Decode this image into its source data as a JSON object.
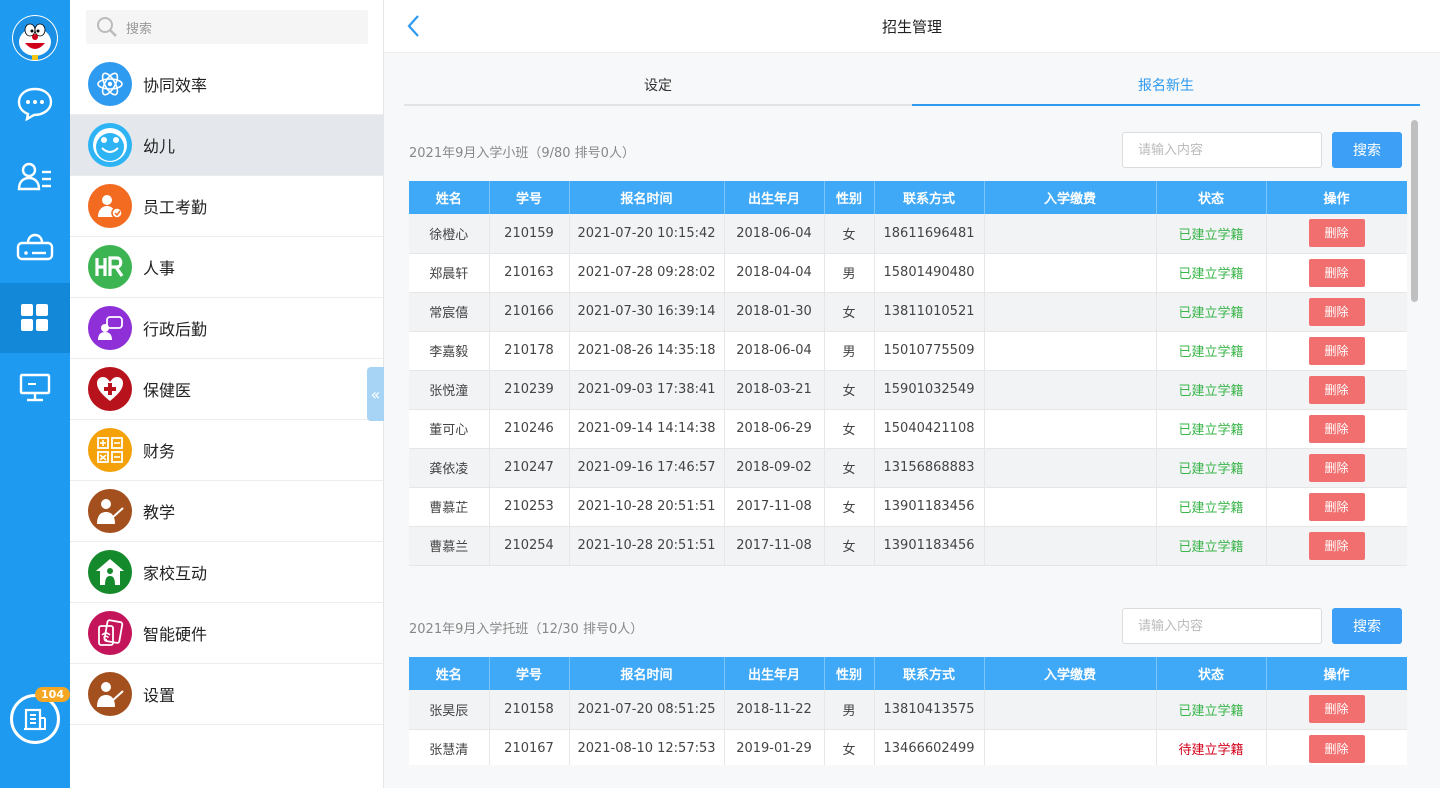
{
  "rail": {
    "badge_count": "104"
  },
  "menu": {
    "search_placeholder": "搜索",
    "items": [
      {
        "label": "协同效率",
        "icon": "atom-icon",
        "color": "#2e9af0"
      },
      {
        "label": "幼儿",
        "icon": "smiley-face-icon",
        "color": "#2e9af0"
      },
      {
        "label": "员工考勤",
        "icon": "staff-attendance-icon",
        "color": "#f26b21"
      },
      {
        "label": "人事",
        "icon": "hr-icon",
        "color": "#3cb451"
      },
      {
        "label": "行政后勤",
        "icon": "admin-logistics-icon",
        "color": "#8e2fd8"
      },
      {
        "label": "保健医",
        "icon": "health-heart-icon",
        "color": "#b8131c"
      },
      {
        "label": "财务",
        "icon": "finance-icon",
        "color": "#f5a10a"
      },
      {
        "label": "教学",
        "icon": "teaching-icon",
        "color": "#a34f1e"
      },
      {
        "label": "家校互动",
        "icon": "home-school-icon",
        "color": "#148a2c"
      },
      {
        "label": "智能硬件",
        "icon": "smart-hardware-icon",
        "color": "#c4155b"
      },
      {
        "label": "设置",
        "icon": "settings-person-icon",
        "color": "#a34f1e"
      }
    ]
  },
  "header": {
    "title": "招生管理"
  },
  "tabs": [
    {
      "label": "设定"
    },
    {
      "label": "报名新生"
    }
  ],
  "table_headers": [
    "姓名",
    "学号",
    "报名时间",
    "出生年月",
    "性别",
    "联系方式",
    "入学缴费",
    "状态",
    "操作"
  ],
  "sections": [
    {
      "title": "2021年9月入学小班（9/80 排号0人）",
      "search_placeholder": "请输入内容",
      "search_button": "搜索",
      "rows": [
        {
          "name": "徐橙心",
          "id": "210159",
          "time": "2021-07-20 10:15:42",
          "birth": "2018-06-04",
          "gender": "女",
          "phone": "18611696481",
          "fee": "",
          "status": "已建立学籍",
          "action": "删除"
        },
        {
          "name": "郑晨轩",
          "id": "210163",
          "time": "2021-07-28 09:28:02",
          "birth": "2018-04-04",
          "gender": "男",
          "phone": "15801490480",
          "fee": "",
          "status": "已建立学籍",
          "action": "删除"
        },
        {
          "name": "常宸僖",
          "id": "210166",
          "time": "2021-07-30 16:39:14",
          "birth": "2018-01-30",
          "gender": "女",
          "phone": "13811010521",
          "fee": "",
          "status": "已建立学籍",
          "action": "删除"
        },
        {
          "name": "李嘉毅",
          "id": "210178",
          "time": "2021-08-26 14:35:18",
          "birth": "2018-06-04",
          "gender": "男",
          "phone": "15010775509",
          "fee": "",
          "status": "已建立学籍",
          "action": "删除"
        },
        {
          "name": "张悦潼",
          "id": "210239",
          "time": "2021-09-03 17:38:41",
          "birth": "2018-03-21",
          "gender": "女",
          "phone": "15901032549",
          "fee": "",
          "status": "已建立学籍",
          "action": "删除"
        },
        {
          "name": "董可心",
          "id": "210246",
          "time": "2021-09-14 14:14:38",
          "birth": "2018-06-29",
          "gender": "女",
          "phone": "15040421108",
          "fee": "",
          "status": "已建立学籍",
          "action": "删除"
        },
        {
          "name": "龚依凌",
          "id": "210247",
          "time": "2021-09-16 17:46:57",
          "birth": "2018-09-02",
          "gender": "女",
          "phone": "13156868883",
          "fee": "",
          "status": "已建立学籍",
          "action": "删除"
        },
        {
          "name": "曹慕芷",
          "id": "210253",
          "time": "2021-10-28 20:51:51",
          "birth": "2017-11-08",
          "gender": "女",
          "phone": "13901183456",
          "fee": "",
          "status": "已建立学籍",
          "action": "删除"
        },
        {
          "name": "曹慕兰",
          "id": "210254",
          "time": "2021-10-28 20:51:51",
          "birth": "2017-11-08",
          "gender": "女",
          "phone": "13901183456",
          "fee": "",
          "status": "已建立学籍",
          "action": "删除"
        }
      ]
    },
    {
      "title": "2021年9月入学托班（12/30 排号0人）",
      "search_placeholder": "请输入内容",
      "search_button": "搜索",
      "rows": [
        {
          "name": "张昊辰",
          "id": "210158",
          "time": "2021-07-20 08:51:25",
          "birth": "2018-11-22",
          "gender": "男",
          "phone": "13810413575",
          "fee": "",
          "status": "已建立学籍",
          "action": "删除"
        },
        {
          "name": "张慧清",
          "id": "210167",
          "time": "2021-08-10 12:57:53",
          "birth": "2019-01-29",
          "gender": "女",
          "phone": "13466602499",
          "fee": "",
          "status": "待建立学籍",
          "action": "删除"
        }
      ]
    }
  ],
  "colors": {
    "rail": "#1e9bf0",
    "accent": "#2e9af0",
    "header_row": "#40a9f7",
    "status_ok": "#3ab54a",
    "status_pending": "#d0021b",
    "delete": "#f26f6f"
  }
}
